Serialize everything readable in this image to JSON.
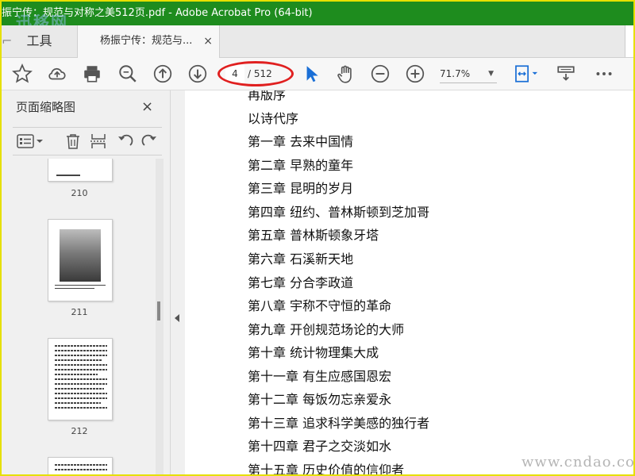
{
  "window": {
    "title": "振宁传：规范与对称之美512页.pdf - Adobe Acrobat Pro (64-bit)"
  },
  "watermarks": {
    "top": "迅移网",
    "bottom": "www.cndao.com"
  },
  "tabs": {
    "tools_label": "工具",
    "document_label": "杨振宁传：规范与...",
    "close_glyph": "×"
  },
  "toolbar": {
    "icons": [
      "star-icon",
      "cloud-upload-icon",
      "print-icon",
      "zoom-search-icon",
      "page-up-icon",
      "page-down-icon",
      "select-cursor-icon",
      "hand-icon",
      "zoom-out-icon",
      "zoom-in-icon",
      "fit-page-icon",
      "page-display-icon",
      "more-icon"
    ],
    "current_page": "4",
    "total_pages": "/ 512",
    "zoom": "71.7%"
  },
  "left_panel": {
    "title": "页面缩略图",
    "close_glyph": "×",
    "thumbnails": [
      {
        "label": "210"
      },
      {
        "label": "211"
      },
      {
        "label": "212"
      }
    ]
  },
  "document": {
    "partial_top_line": "再版序",
    "lines": [
      "以诗代序",
      "第一章 去来中国情",
      "第二章 早熟的童年",
      "第三章 昆明的岁月",
      "第四章 纽约、普林斯顿到芝加哥",
      "第五章 普林斯顿象牙塔",
      "第六章 石溪新天地",
      "第七章 分合李政道",
      "第八章 宇称不守恒的革命",
      "第九章 开创规范场论的大师",
      "第十章 统计物理集大成",
      "第十一章 有生应感国恩宏",
      "第十二章 每饭勿忘亲爱永",
      "第十三章 追求科学美感的独行者",
      "第十四章 君子之交淡如水",
      "第十五章 历史价值的信仰者"
    ]
  },
  "colors": {
    "titlebar": "#1e8c1e",
    "frame": "#e6e000",
    "highlight_ellipse": "#e02020",
    "select_cursor": "#1a6fd6"
  }
}
